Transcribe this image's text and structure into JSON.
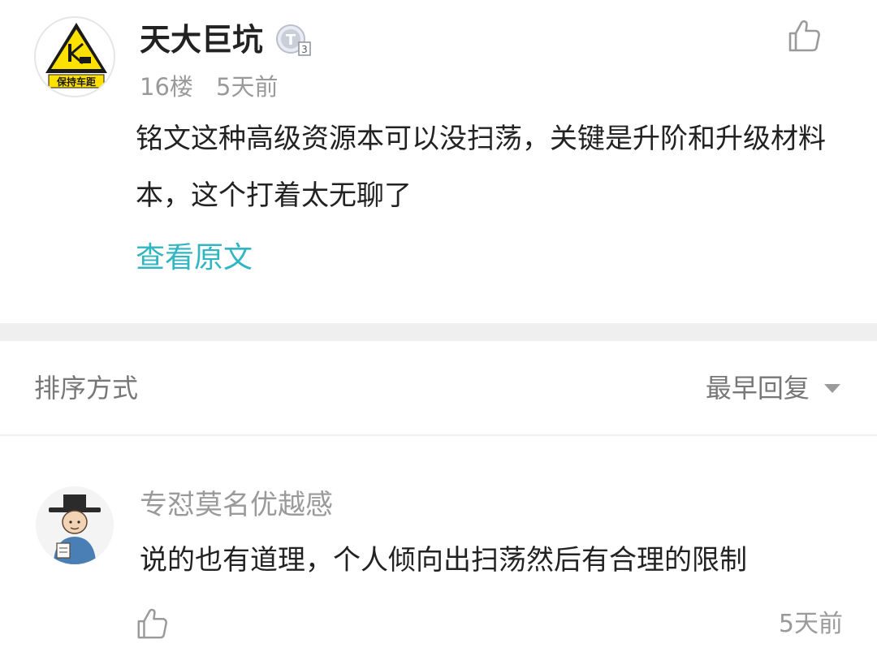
{
  "main_post": {
    "author": "天大巨坑",
    "avatar_sign_text": "保持车距",
    "level_badge_letter": "T",
    "level_badge_number": "3",
    "floor": "16楼",
    "time": "5天前",
    "content": "铭文这种高级资源本可以没扫荡，关键是升阶和升级材料本，这个打着太无聊了",
    "view_original": "查看原文",
    "like_icon": "thumbs-up-icon"
  },
  "sort": {
    "label": "排序方式",
    "value": "最早回复",
    "arrow_icon": "caret-down-icon"
  },
  "reply": {
    "author": "专怼莫名优越感",
    "content": "说的也有道理，个人倾向出扫荡然后有合理的限制",
    "time": "5天前",
    "like_icon": "thumbs-up-icon"
  },
  "colors": {
    "text_primary": "#222222",
    "text_secondary": "#9a9a9a",
    "link": "#2fb6c2",
    "separator": "#efefef",
    "warning_yellow": "#ffe100"
  }
}
